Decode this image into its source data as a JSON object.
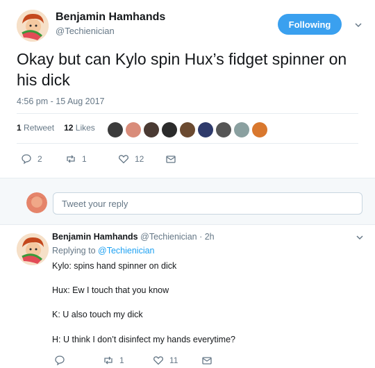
{
  "tweet": {
    "author_name": "Benjamin Hamhands",
    "author_handle": "@Techienician",
    "follow_label": "Following",
    "text": "Okay but can Kylo spin Hux’s fidget spinner on his dick",
    "timestamp": "4:56 pm - 15 Aug 2017",
    "stats": {
      "retweets_count": "1",
      "retweets_label": "Retweet",
      "likes_count": "12",
      "likes_label": "Likes"
    },
    "likers": [
      "#3b3b3b",
      "#d98c7a",
      "#4a3a33",
      "#2b2b2b",
      "#6b4a30",
      "#2e3a6b",
      "#555555",
      "#8aa0a0",
      "#d9782e"
    ],
    "actions": {
      "reply_count": "2",
      "retweet_count": "1",
      "like_count": "12"
    }
  },
  "reply_input": {
    "placeholder": "Tweet your reply"
  },
  "reply": {
    "author_name": "Benjamin Hamhands",
    "meta": "@Techienician · 2h",
    "replying_prefix": "Replying to ",
    "replying_handle": "@Techienician",
    "lines": [
      "Kylo: spins hand spinner on dick",
      "Hux: Ew I touch that you know",
      "K: U also touch my dick",
      "H: U think I don’t disinfect my hands everytime?"
    ],
    "actions": {
      "reply_count": "",
      "retweet_count": "1",
      "like_count": "11"
    }
  },
  "colors": {
    "accent": "#1da1f2",
    "follow_bg": "#3aa0ef",
    "muted": "#657786"
  }
}
